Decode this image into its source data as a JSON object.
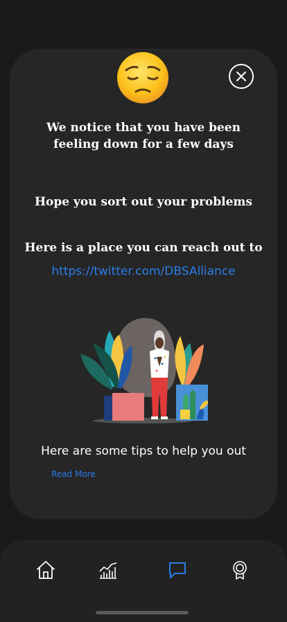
{
  "popup": {
    "headline": "We notice that you have been feeling down for a few days",
    "support_message": "Hope you sort out your problems",
    "reach_out_text": "Here is a place you can reach out to",
    "link_url": "https://twitter.com/DBSAlliance",
    "tips_text": "Here are some tips to help you out",
    "read_more_label": "Read More",
    "emoji": "pensive-face-icon",
    "close_icon": "close-icon"
  },
  "nav": {
    "items": [
      {
        "name": "home",
        "icon": "home-icon"
      },
      {
        "name": "stats",
        "icon": "chart-icon"
      },
      {
        "name": "chat",
        "icon": "chat-icon",
        "active": true
      },
      {
        "name": "achievements",
        "icon": "badge-icon"
      }
    ],
    "active_color": "#2b7de9",
    "inactive_color": "#ffffff"
  },
  "colors": {
    "background": "#1a1a1a",
    "card": "#262626",
    "link": "#2b7de9"
  }
}
